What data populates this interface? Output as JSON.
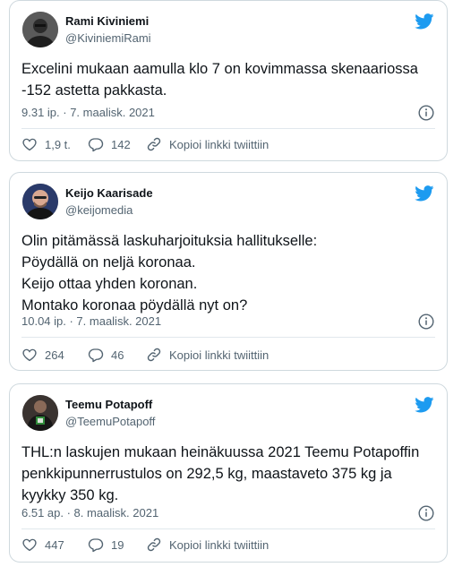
{
  "colors": {
    "twitter_blue": "#1d9bf0",
    "text_primary": "#0f1419",
    "text_secondary": "#536471",
    "border": "#cfd9de"
  },
  "tweets": [
    {
      "author_name": "Rami Kiviniemi",
      "handle": "@KiviniemiRami",
      "text_lines": [
        "Excelini mukaan aamulla klo 7 on kovimmassa skenaariossa",
        "-152 astetta pakkasta."
      ],
      "timestamp": "9.31 ip. · 7. maalisk. 2021",
      "likes": "1,9 t.",
      "replies": "142",
      "copy_link_label": "Kopioi linkki twiittiin",
      "icons": {
        "brand": "twitter-bird-icon",
        "info": "info-icon",
        "like": "heart-icon",
        "reply": "reply-bubble-icon",
        "link": "link-icon"
      }
    },
    {
      "author_name": "Keijo Kaarisade",
      "handle": "@keijomedia",
      "text_lines": [
        "Olin pitämässä laskuharjoituksia hallitukselle:",
        "Pöydällä on neljä koronaa.",
        "Keijo ottaa yhden koronan.",
        "Montako koronaa pöydällä nyt on?"
      ],
      "timestamp": "10.04 ip. · 7. maalisk. 2021",
      "likes": "264",
      "replies": "46",
      "copy_link_label": "Kopioi linkki twiittiin",
      "icons": {
        "brand": "twitter-bird-icon",
        "info": "info-icon",
        "like": "heart-icon",
        "reply": "reply-bubble-icon",
        "link": "link-icon"
      }
    },
    {
      "author_name": "Teemu Potapoff",
      "handle": "@TeemuPotapoff",
      "text_lines": [
        "THL:n laskujen mukaan heinäkuussa 2021 Teemu Potapoffin",
        "penkkipunnerrustulos on 292,5 kg, maastaveto 375 kg ja",
        "kyykky 350 kg."
      ],
      "timestamp": "6.51 ap. · 8. maalisk. 2021",
      "likes": "447",
      "replies": "19",
      "copy_link_label": "Kopioi linkki twiittiin",
      "icons": {
        "brand": "twitter-bird-icon",
        "info": "info-icon",
        "like": "heart-icon",
        "reply": "reply-bubble-icon",
        "link": "link-icon"
      }
    }
  ]
}
